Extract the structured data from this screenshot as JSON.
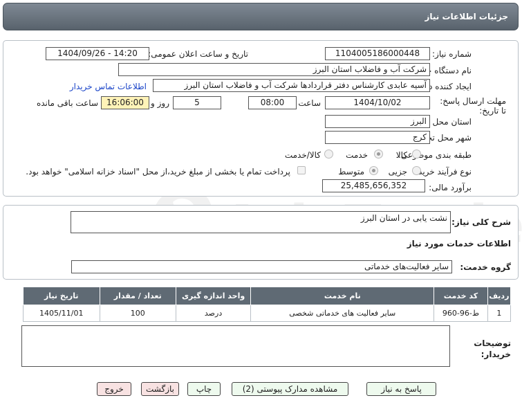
{
  "header": {
    "title": "جزئیات اطلاعات نیاز"
  },
  "form": {
    "need_number_label": "شماره نیاز:",
    "need_number": "1104005186000448",
    "announce_label": "تاریخ و ساعت اعلان عمومی:",
    "announce_value": "1404/09/26 - 14:20",
    "buyer_label": "نام دستگاه خریدار:",
    "buyer_value": "شرکت آب و فاضلاب استان البرز",
    "creator_label": "ایجاد کننده درخواست:",
    "creator_value": "آسیه عابدی کارشناس دفتر قراردادها شرکت آب و فاضلاب استان البرز",
    "contact_link": "اطلاعات تماس خریدار",
    "deadline_label": "مهلت ارسال پاسخ: تا تاریخ:",
    "deadline_date": "1404/10/02",
    "time_label": "ساعت",
    "deadline_time": "08:00",
    "days_value": "5",
    "days_label": "روز و",
    "remaining_time": "16:06:00",
    "remaining_label": "ساعت باقی مانده",
    "province_label": "استان محل تحویل:",
    "province_value": "البرز",
    "city_label": "شهر محل تحویل:",
    "city_value": "کرج",
    "category_label": "طبقه بندی موضوعی:",
    "category_options": [
      "کالا",
      "خدمت",
      "کالا/خدمت"
    ],
    "purchase_label": "نوع فرآیند خرید :",
    "purchase_options": [
      "جزیی",
      "متوسط"
    ],
    "payment_note": "پرداخت تمام یا بخشی از مبلغ خرید،از محل \"اسناد خزانه اسلامی\" خواهد بود.",
    "budget_label": "برآورد مالی:",
    "budget_value": "25,485,656,352"
  },
  "description": {
    "label": "شرح کلی نیاز:",
    "value": "نشت یابی در استان البرز"
  },
  "services": {
    "section_title": "اطلاعات خدمات مورد نیاز",
    "group_label": "گروه خدمت:",
    "group_value": "سایر فعالیت‌های خدماتی",
    "columns": [
      "ردیف",
      "کد خدمت",
      "نام خدمت",
      "واحد اندازه گیری",
      "تعداد / مقدار",
      "تاریخ نیاز"
    ],
    "rows": [
      [
        "1",
        "ط-96-960",
        "سایر فعالیت های خدماتی شخصی",
        "درصد",
        "100",
        "1405/11/01"
      ]
    ]
  },
  "notes": {
    "label": "توضیحات خریدار:",
    "value": ""
  },
  "buttons": {
    "reply": "پاسخ به نیاز",
    "docs": "مشاهده مدارک پیوستی (2)",
    "print": "چاپ",
    "back": "بازگشت",
    "exit": "خروج"
  },
  "watermark": {
    "text": "AriaTender.neT"
  },
  "colors": {
    "header": "#5f6a74",
    "link": "#1a44c8",
    "remaining_bg": "#fff3b8",
    "button_green": "#eefaee",
    "button_red": "#f8e2e2"
  }
}
